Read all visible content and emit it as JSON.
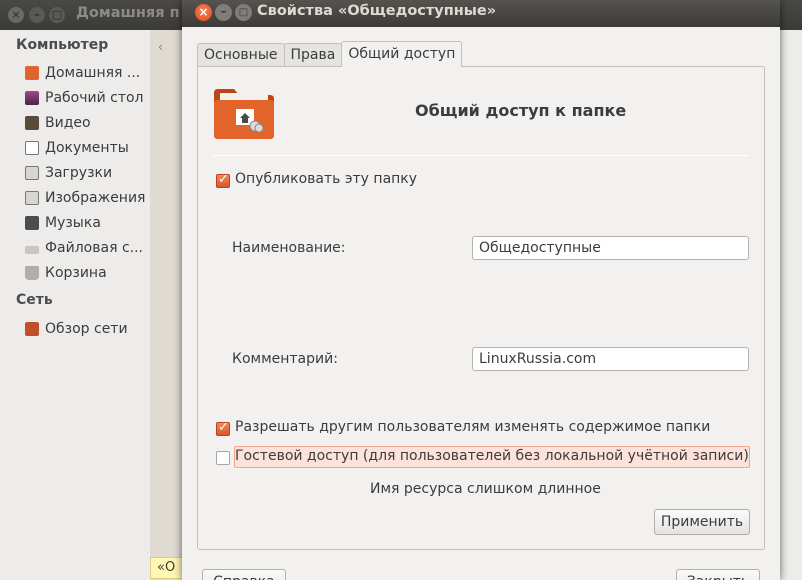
{
  "background_window": {
    "title": "Домашняя п",
    "back_label": "‹",
    "status_text": "«О",
    "sidebar": {
      "computer_header": "Компьютер",
      "computer_items": [
        {
          "label": "Домашняя ...",
          "icon": "home-folder-icon",
          "color": "#e0642d"
        },
        {
          "label": "Рабочий стол",
          "icon": "desktop-icon",
          "color": "#7a3b6e"
        },
        {
          "label": "Видео",
          "icon": "video-icon",
          "color": "#5a4a3a"
        },
        {
          "label": "Документы",
          "icon": "documents-icon",
          "color": "#6b6b6b"
        },
        {
          "label": "Загрузки",
          "icon": "downloads-icon",
          "color": "#6b6b6b"
        },
        {
          "label": "Изображения",
          "icon": "pictures-icon",
          "color": "#6b6b6b"
        },
        {
          "label": "Музыка",
          "icon": "music-icon",
          "color": "#4c4c4c"
        },
        {
          "label": "Файловая с...",
          "icon": "filesystem-icon",
          "color": "#9a9a9a"
        },
        {
          "label": "Корзина",
          "icon": "trash-icon",
          "color": "#8a8a8a"
        }
      ],
      "network_header": "Сеть",
      "network_items": [
        {
          "label": "Обзор сети",
          "icon": "network-icon",
          "color": "#c0502a"
        }
      ]
    }
  },
  "dialog": {
    "title": "Свойства «Общедоступные»",
    "tabs": [
      {
        "label": "Основные",
        "active": false
      },
      {
        "label": "Права",
        "active": false
      },
      {
        "label": "Общий доступ",
        "active": true
      }
    ],
    "heading": "Общий доступ к папке",
    "publish_label": "Опубликовать эту папку",
    "publish_checked": true,
    "name_label": "Наименование:",
    "name_value": "Общедоступные",
    "comment_label": "Комментарий:",
    "comment_value": "LinuxRussia.com",
    "allow_modify_label": "Разрешать другим пользователям изменять содержимое папки",
    "allow_modify_checked": true,
    "guest_label": "Гостевой доступ (для пользователей без локальной учётной записи)",
    "guest_checked": false,
    "error_message": "Имя ресурса слишком длинное",
    "apply_label": "Применить",
    "help_label": "Справка",
    "close_label": "Закрыть"
  },
  "colors": {
    "accent": "#dd4814",
    "error_bg": "#fde2d9",
    "titlebar": "#3c3b37"
  }
}
